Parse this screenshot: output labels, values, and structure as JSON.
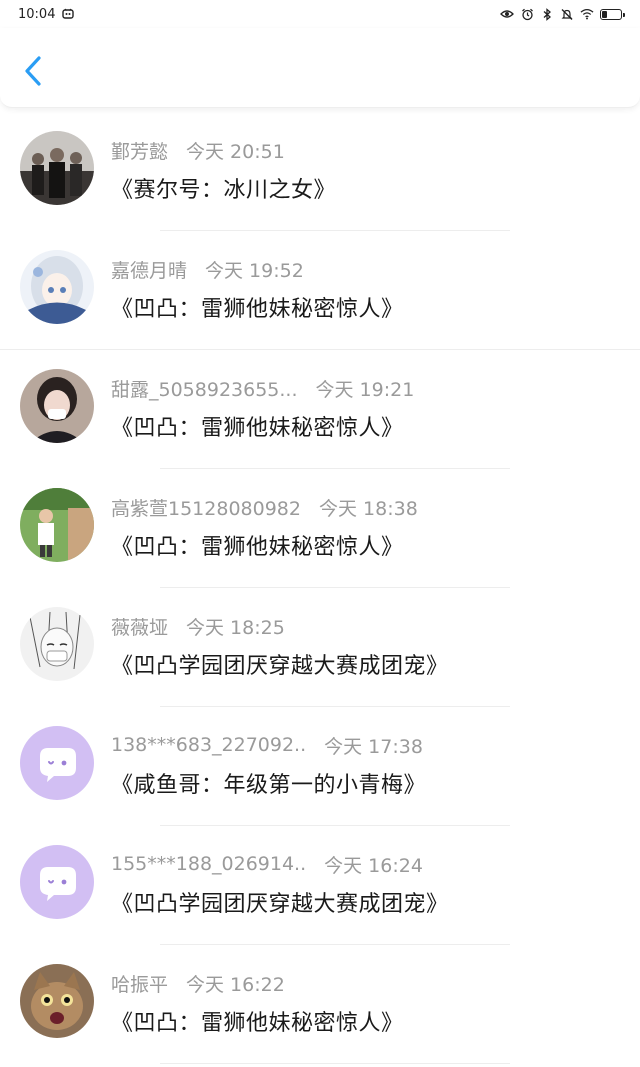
{
  "status_bar": {
    "time": "10:04",
    "battery_level": 0.3,
    "icons": [
      "notification-icon",
      "eye-icon",
      "alarm-icon",
      "bluetooth-icon",
      "silent-icon",
      "wifi-icon",
      "battery-icon"
    ]
  },
  "header": {
    "back_icon": "chevron-left-icon",
    "accent_color": "#2a9df4"
  },
  "items": [
    {
      "name": "鄞芳懿",
      "time": "今天 20:51",
      "title": "《赛尔号：冰川之女》",
      "avatar": "photo"
    },
    {
      "name": "嘉德月晴",
      "time": "今天 19:52",
      "title": "《凹凸：雷狮他妹秘密惊人》",
      "avatar": "anime"
    },
    {
      "name": "甜露_5058923655...",
      "time": "今天 19:21",
      "title": "《凹凸：雷狮他妹秘密惊人》",
      "avatar": "photo-girl"
    },
    {
      "name": "高紫萱15128080982",
      "time": "今天 18:38",
      "title": "《凹凸：雷狮他妹秘密惊人》",
      "avatar": "photo-outdoor"
    },
    {
      "name": "薇薇垭",
      "time": "今天 18:25",
      "title": "《凹凸学园团厌穿越大赛成团宠》",
      "avatar": "sketch"
    },
    {
      "name": "138***683_227092..",
      "time": "今天 17:38",
      "title": "《咸鱼哥：年级第一的小青梅》",
      "avatar": "default"
    },
    {
      "name": "155***188_026914..",
      "time": "今天 16:24",
      "title": "《凹凸学园团厌穿越大赛成团宠》",
      "avatar": "default"
    },
    {
      "name": "哈振平",
      "time": "今天 16:22",
      "title": "《凹凸：雷狮他妹秘密惊人》",
      "avatar": "cat"
    }
  ]
}
